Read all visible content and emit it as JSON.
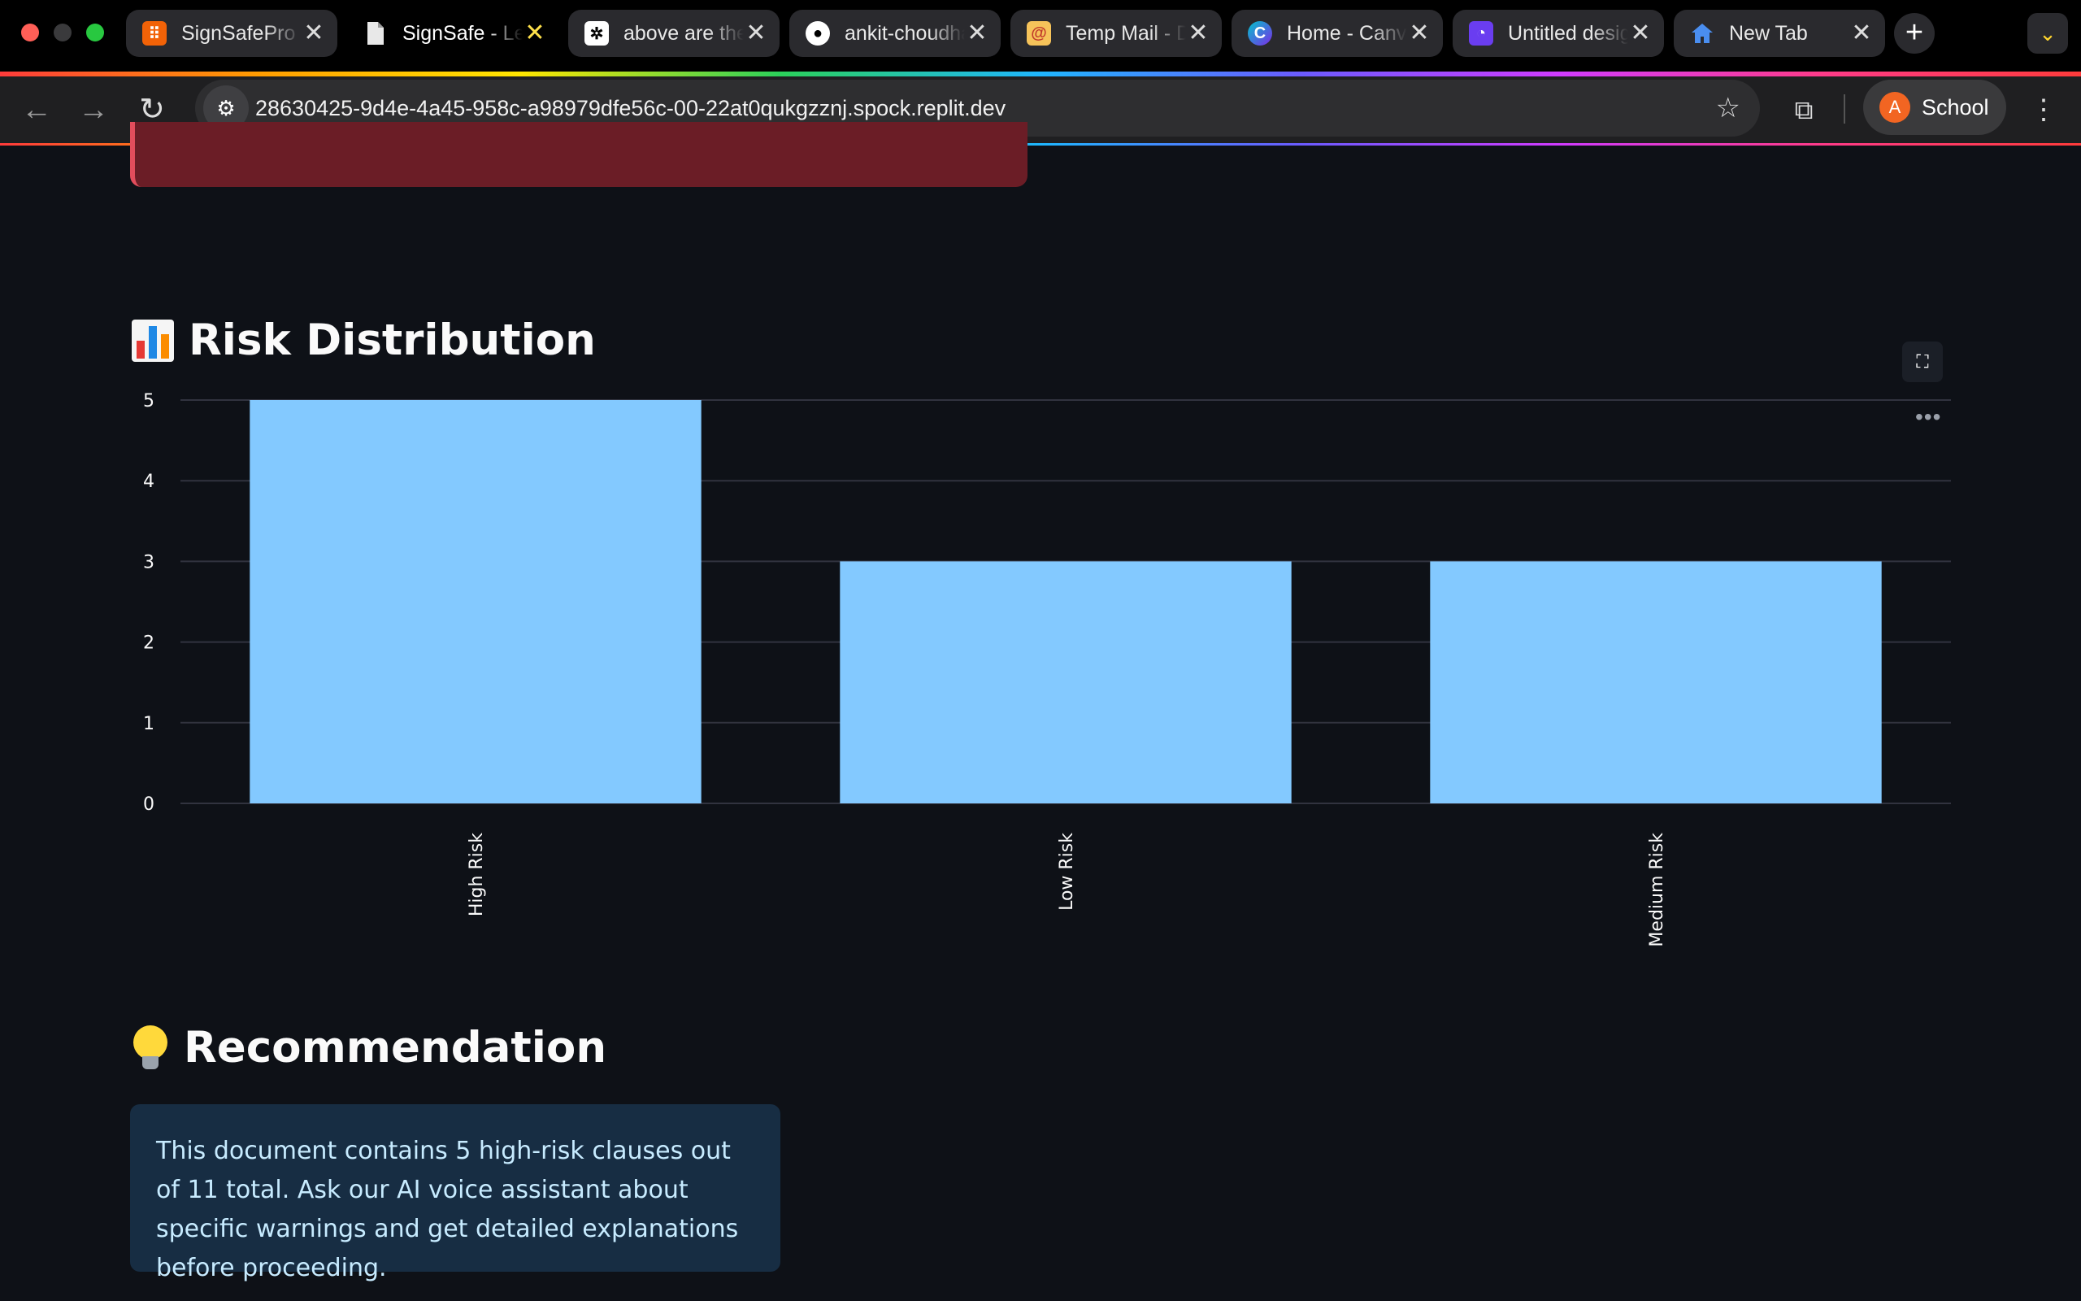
{
  "browser": {
    "tabs": [
      {
        "title": "SignSafePro",
        "favicon": "replit-icon",
        "active": false
      },
      {
        "title": "SignSafe - Legal",
        "favicon": "document-icon",
        "active": true
      },
      {
        "title": "above are the",
        "favicon": "openai-icon",
        "active": false
      },
      {
        "title": "ankit-choudhary",
        "favicon": "github-icon",
        "active": false
      },
      {
        "title": "Temp Mail - Disposable",
        "favicon": "mail-icon",
        "active": false
      },
      {
        "title": "Home - Canva",
        "favicon": "canva-icon",
        "active": false
      },
      {
        "title": "Untitled design",
        "favicon": "design-icon",
        "active": false
      },
      {
        "title": "New Tab",
        "favicon": "home-icon",
        "active": false
      }
    ],
    "new_tab_glyph": "+",
    "tab_close_glyph": "✕",
    "tab_menu_glyph": "⌄",
    "nav": {
      "back": "←",
      "forward": "→",
      "reload": "↻"
    },
    "url": "28630425-9d4e-4a45-958c-a98979dfe56c-00-22at0qukgzznj.spock.replit.dev",
    "star_glyph": "☆",
    "extensions_glyph": "⧉",
    "profile": {
      "initial": "A",
      "name": "School"
    },
    "menu_glyph": "⋮"
  },
  "risk_section": {
    "title": "Risk Distribution",
    "icon": "bar-chart-icon",
    "fullscreen_glyph": "⛶",
    "more_glyph": "•••"
  },
  "chart_data": {
    "type": "bar",
    "categories": [
      "High Risk",
      "Low Risk",
      "Medium Risk"
    ],
    "values": [
      5,
      3,
      3
    ],
    "ylim": [
      0,
      5
    ],
    "yticks": [
      0,
      1,
      2,
      3,
      4,
      5
    ],
    "bar_color": "#83c9ff",
    "grid": true,
    "title": "",
    "xlabel": "",
    "ylabel": ""
  },
  "recommendation": {
    "title": "Recommendation",
    "icon": "lightbulb-icon",
    "text": "This document contains 5 high-risk clauses out of 11 total. Ask our AI voice assistant about specific warnings and get detailed explanations before proceeding."
  },
  "colors": {
    "page_bg": "#0e1117",
    "error_bg": "#6b1d26",
    "info_bg": "#172d43",
    "info_text": "#c7ebff"
  }
}
